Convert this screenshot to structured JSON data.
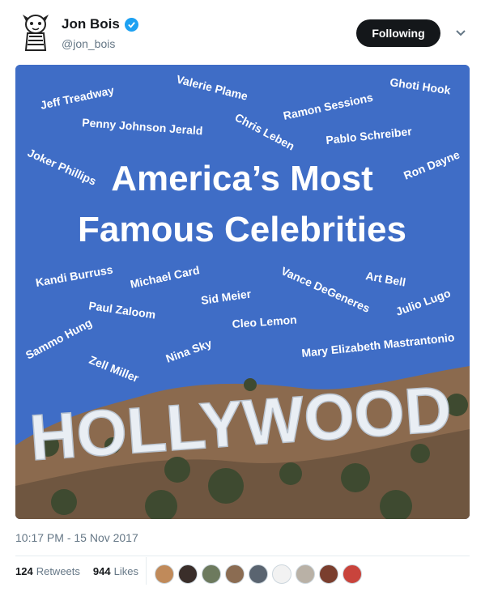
{
  "tweet": {
    "display_name": "Jon Bois",
    "handle": "@jon_bois",
    "follow_label": "Following",
    "timestamp": "10:17 PM - 15 Nov 2017",
    "retweets_count": "124",
    "retweets_label": "Retweets",
    "likes_count": "944",
    "likes_label": "Likes"
  },
  "image": {
    "title_line1": "America’s Most",
    "title_line2": "Famous Celebrities",
    "sign": "HOLLYWOOD",
    "names": [
      "Jeff Treadway",
      "Valerie Plame",
      "Ghoti Hook",
      "Ramon Sessions",
      "Penny Johnson Jerald",
      "Chris Leben",
      "Pablo Schreiber",
      "Joker Phillips",
      "Ron Dayne",
      "Kandi Burruss",
      "Michael Card",
      "Vance DeGeneres",
      "Art Bell",
      "Sid Meier",
      "Paul Zaloom",
      "Julio Lugo",
      "Cleo Lemon",
      "Sammo Hung",
      "Nina Sky",
      "Mary Elizabeth Mastrantonio",
      "Zell Miller"
    ]
  },
  "colors": {
    "sky": "#3f6dc6",
    "accent": "#1da1f2",
    "button": "#14171a",
    "muted": "#657786"
  },
  "icons": {
    "verified": "verified-badge-icon",
    "chevron": "chevron-down-icon"
  },
  "likers": [
    "#c08a5a",
    "#3a2e2a",
    "#6d7a5e",
    "#8b6c52",
    "#5a6470",
    "#f2f2f2",
    "#b9b1a6",
    "#7a3e2e",
    "#c9443c"
  ]
}
